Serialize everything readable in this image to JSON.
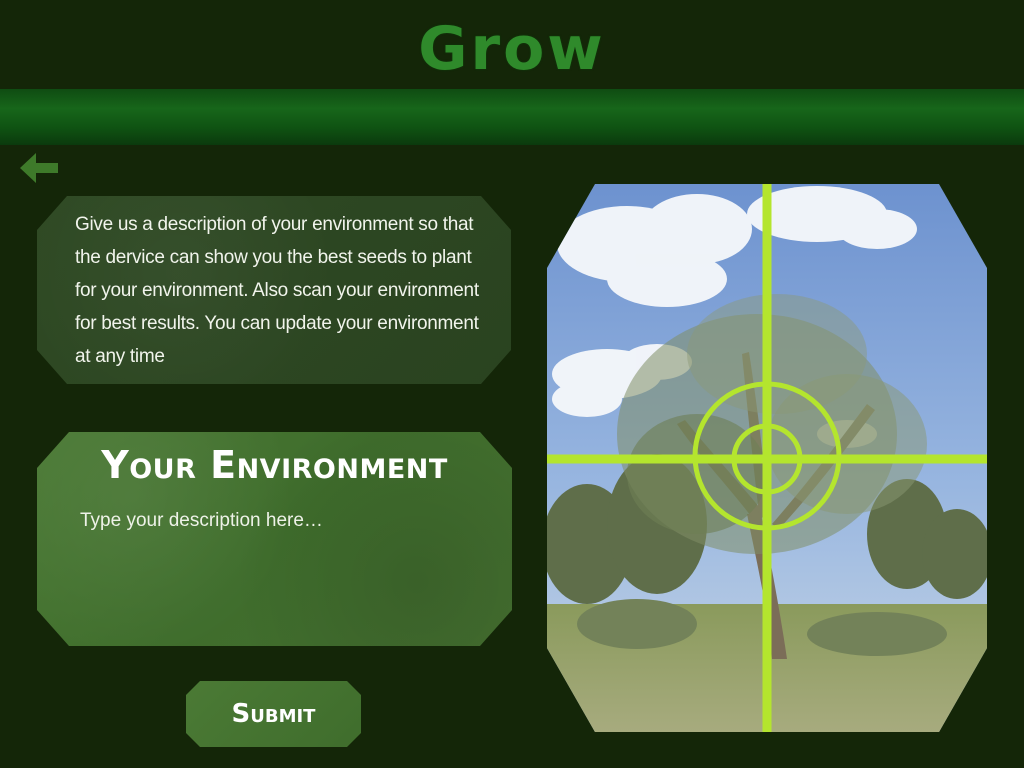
{
  "app": {
    "title": "Grow"
  },
  "nav": {
    "back_icon": "arrow-left-icon"
  },
  "info": {
    "text": "Give us a description of your environment so that the dervice can show you the best seeds to plant for your environment.  Also scan your environment for best results.  You can update your environment at any time"
  },
  "environment": {
    "heading": "Your Environment",
    "placeholder": "Type your description here…",
    "value": ""
  },
  "submit": {
    "label": "Submit"
  },
  "scanner": {
    "image": "eucalyptus-tree-landscape",
    "crosshair_color": "#b4e52e"
  },
  "colors": {
    "background": "#142608",
    "title": "#2f8a2b",
    "band": "#17661a",
    "panel": "#446f30",
    "crosshair": "#b4e52e"
  }
}
